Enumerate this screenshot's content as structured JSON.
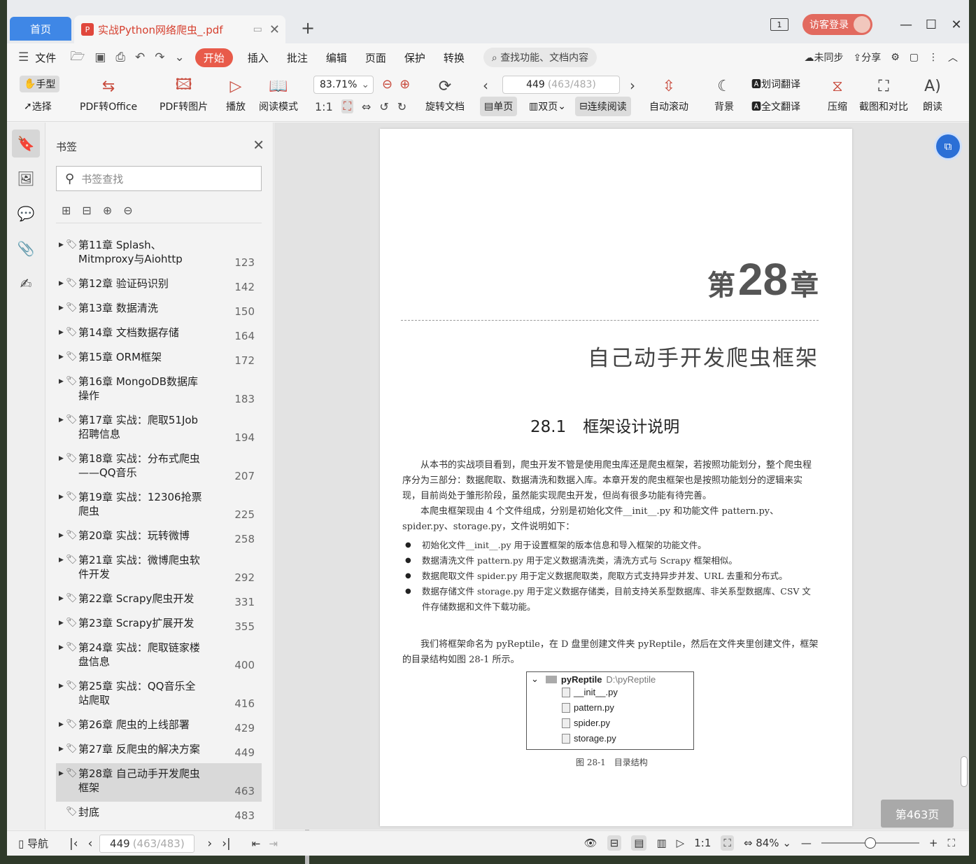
{
  "titlebar": {
    "home_tab": "首页",
    "doc_tab": "实战Python网络爬虫_.pdf",
    "pdf_icon": "P",
    "login": "访客登录",
    "pages_icon_num": "1"
  },
  "menubar": {
    "file": "文件",
    "items": [
      "开始",
      "插入",
      "批注",
      "编辑",
      "页面",
      "保护",
      "转换"
    ],
    "search": "查找功能、文档内容",
    "sync": "未同步",
    "share": "分享"
  },
  "ribbon": {
    "hand": "手型",
    "select": "选择",
    "pdf_office": "PDF转Office",
    "pdf_image": "PDF转图片",
    "play": "播放",
    "read_mode": "阅读模式",
    "zoom": "83.71%",
    "rotate": "旋转文档",
    "page_current": "449",
    "page_total": "(463/483)",
    "single": "单页",
    "double": "双页",
    "continuous": "连续阅读",
    "auto_scroll": "自动滚动",
    "background": "背景",
    "word_translate": "划词翻译",
    "full_translate": "全文翻译",
    "compress": "压缩",
    "screenshot": "截图和对比",
    "read_aloud": "朗读"
  },
  "bookmarks": {
    "header": "书签",
    "search_placeholder": "书签查找",
    "items": [
      {
        "label": "第11章 Splash、Mitmproxy与Aiohttp",
        "page": "123"
      },
      {
        "label": "第12章 验证码识别",
        "page": "142"
      },
      {
        "label": "第13章 数据清洗",
        "page": "150"
      },
      {
        "label": "第14章 文档数据存储",
        "page": "164"
      },
      {
        "label": "第15章 ORM框架",
        "page": "172"
      },
      {
        "label": "第16章 MongoDB数据库操作",
        "page": "183"
      },
      {
        "label": "第17章 实战：爬取51Job招聘信息",
        "page": "194"
      },
      {
        "label": "第18章 实战：分布式爬虫——QQ音乐",
        "page": "207"
      },
      {
        "label": "第19章 实战：12306抢票爬虫",
        "page": "225"
      },
      {
        "label": "第20章 实战：玩转微博",
        "page": "258"
      },
      {
        "label": "第21章 实战：微博爬虫软件开发",
        "page": "292"
      },
      {
        "label": "第22章 Scrapy爬虫开发",
        "page": "331"
      },
      {
        "label": "第23章 Scrapy扩展开发",
        "page": "355"
      },
      {
        "label": "第24章 实战：爬取链家楼盘信息",
        "page": "400"
      },
      {
        "label": "第25章 实战：QQ音乐全站爬取",
        "page": "416"
      },
      {
        "label": "第26章 爬虫的上线部署",
        "page": "429"
      },
      {
        "label": "第27章 反爬虫的解决方案",
        "page": "449"
      },
      {
        "label": "第28章 自己动手开发爬虫框架",
        "page": "463"
      },
      {
        "label": "封底",
        "page": "483"
      }
    ]
  },
  "page": {
    "chapter_prefix": "第",
    "chapter_num": "28",
    "chapter_suffix": "章",
    "chapter_title": "自己动手开发爬虫框架",
    "section_num": "28.1",
    "section_title": "框架设计说明",
    "para1": "从本书的实战项目看到，爬虫开发不管是使用爬虫库还是爬虫框架，若按照功能划分，整个爬虫程序分为三部分：数据爬取、数据清洗和数据入库。本章开发的爬虫框架也是按照功能划分的逻辑来实现，目前尚处于雏形阶段，虽然能实现爬虫开发，但尚有很多功能有待完善。",
    "para2": "本爬虫框架现由 4 个文件组成，分别是初始化文件__init__.py 和功能文件 pattern.py、spider.py、storage.py，文件说明如下：",
    "bullets": [
      "初始化文件__init__.py 用于设置框架的版本信息和导入框架的功能文件。",
      "数据清洗文件 pattern.py 用于定义数据清洗类，清洗方式与 Scrapy 框架相似。",
      "数据爬取文件 spider.py 用于定义数据爬取类，爬取方式支持异步并发、URL 去重和分布式。",
      "数据存储文件 storage.py 用于定义数据存储类，目前支持关系型数据库、非关系型数据库、CSV 文件存储数据和文件下载功能。"
    ],
    "para3": "我们将框架命名为 pyReptile，在 D 盘里创建文件夹 pyReptile，然后在文件夹里创建文件，框架的目录结构如图 28-1 所示。",
    "tree_root": "pyReptile",
    "tree_path": "D:\\pyReptile",
    "tree_files": [
      "__init__.py",
      "pattern.py",
      "spider.py",
      "storage.py"
    ],
    "figure_caption": "图 28-1　目录结构"
  },
  "page_badge": "第463页",
  "statusbar": {
    "nav": "导航",
    "page_current": "449",
    "page_total": "(463/483)",
    "zoom": "84%"
  }
}
